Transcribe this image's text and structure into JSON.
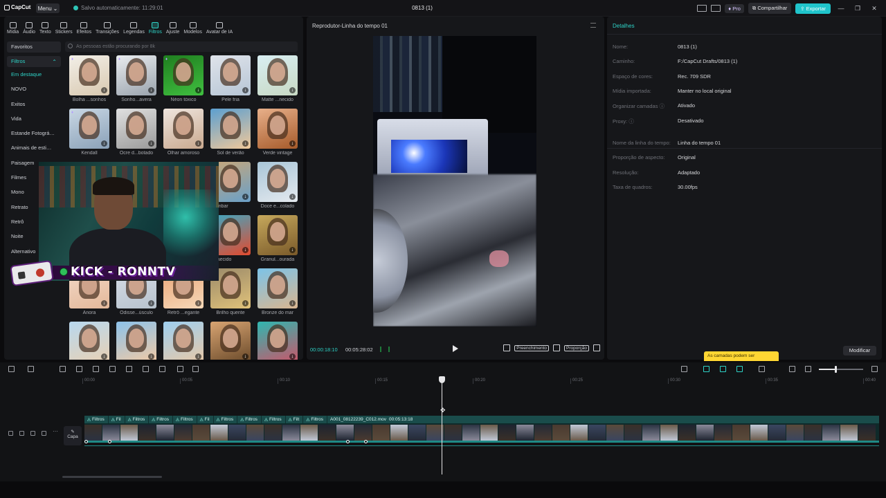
{
  "app": {
    "logo": "CapCut",
    "menu_label": "Menu",
    "autosave": "Salvo automaticamente: 11:29:01",
    "project_title": "0813 (1)",
    "pro_label": "Pro",
    "share_label": "Compartilhar",
    "export_label": "Exportar",
    "accent_color": "#20c4cb"
  },
  "toolbar": {
    "tools": [
      {
        "label": "Mídia",
        "icon": "media-icon"
      },
      {
        "label": "Áudio",
        "icon": "audio-icon"
      },
      {
        "label": "Texto",
        "icon": "text-icon"
      },
      {
        "label": "Stickers",
        "icon": "sticker-icon"
      },
      {
        "label": "Efeitos",
        "icon": "effects-icon"
      },
      {
        "label": "Transições",
        "icon": "transition-icon"
      },
      {
        "label": "Legendas",
        "icon": "captions-icon"
      },
      {
        "label": "Filtros",
        "icon": "filters-icon"
      },
      {
        "label": "Ajuste",
        "icon": "adjust-icon"
      },
      {
        "label": "Modelos",
        "icon": "templates-icon"
      },
      {
        "label": "Avatar de IA",
        "icon": "ai-avatar-icon"
      }
    ],
    "active": "Filtros"
  },
  "categories": {
    "favoritos": "Favoritos",
    "filtros": "Filtros",
    "items": [
      "Em destaque",
      "NOVO",
      "Exitos",
      "Vida",
      "Estande Fotográ…",
      "Animais de esti…",
      "Paisagem",
      "Filmes",
      "Mono",
      "Retrato",
      "Retrô",
      "Noite",
      "Alternativo"
    ]
  },
  "search": {
    "placeholder": "As pessoas estão procurando por 8k"
  },
  "filters": [
    {
      "label": "Bolha ...sonhos"
    },
    {
      "label": "Sonho...avera"
    },
    {
      "label": "Néon tóxico"
    },
    {
      "label": "Pele fria"
    },
    {
      "label": "Matte ...necido"
    },
    {
      "label": "Kendall"
    },
    {
      "label": "Ocre d...botado"
    },
    {
      "label": "Olhar amoroso"
    },
    {
      "label": "Sol de verão"
    },
    {
      "label": "Verde vintage"
    },
    {
      "label": "o âmbar"
    },
    {
      "label": "Doce e...colado"
    },
    {
      "label": "e...aecido"
    },
    {
      "label": "Granul...ourada"
    },
    {
      "label": "Anora"
    },
    {
      "label": "Odisse...úsculo"
    },
    {
      "label": "Retrô ...egante"
    },
    {
      "label": "Brilho quente"
    },
    {
      "label": "Bronze do mar"
    }
  ],
  "overlay": {
    "banner_text": "KICK - RONNTV"
  },
  "player": {
    "title": "Reprodutor-Linha do tempo 01",
    "current_time": "00:00:18:10",
    "total_time": "00:05:28:02",
    "fill_label": "Preenchimento",
    "ratio_label": "Proporção"
  },
  "details": {
    "title": "Detalhes",
    "rows": [
      {
        "key": "Nome:",
        "value": "0813 (1)"
      },
      {
        "key": "Caminho:",
        "value": "F:/CapCut Drafts/0813 (1)"
      },
      {
        "key": "Espaço de cores:",
        "value": "Rec. 709 SDR"
      },
      {
        "key": "Mídia importada:",
        "value": "Manter no local original"
      },
      {
        "key": "Organizar camadas ⓘ",
        "value": "Ativado"
      },
      {
        "key": "Proxy: ⓘ",
        "value": "Desativado"
      }
    ],
    "rows2": [
      {
        "key": "Nome da linha do tempo:",
        "value": "Linha do tempo 01"
      },
      {
        "key": "Proporção de aspecto:",
        "value": "Original"
      },
      {
        "key": "Resolução:",
        "value": "Adaptado"
      },
      {
        "key": "Taxa de quadros:",
        "value": "30.00fps"
      }
    ],
    "tooltip": "As camadas podem ser",
    "modify_label": "Modificar"
  },
  "timeline": {
    "ruler": [
      "00:00",
      "00:05",
      "00:10",
      "00:15",
      "00:20",
      "00:25",
      "00:30",
      "00:35",
      "00:40"
    ],
    "ruler_tail": [
      "00:30",
      "00:40"
    ],
    "cover_label": "Capa",
    "filter_chips": [
      "Filtros",
      "Fil",
      "Filtros",
      "Filtros",
      "Filtros",
      "Fil",
      "Filtros",
      "Filtros",
      "Filtros",
      "Filt",
      "Filtros"
    ],
    "clip_name": "A001_08122239_C012.mov",
    "clip_duration": "00:05:13:18"
  }
}
